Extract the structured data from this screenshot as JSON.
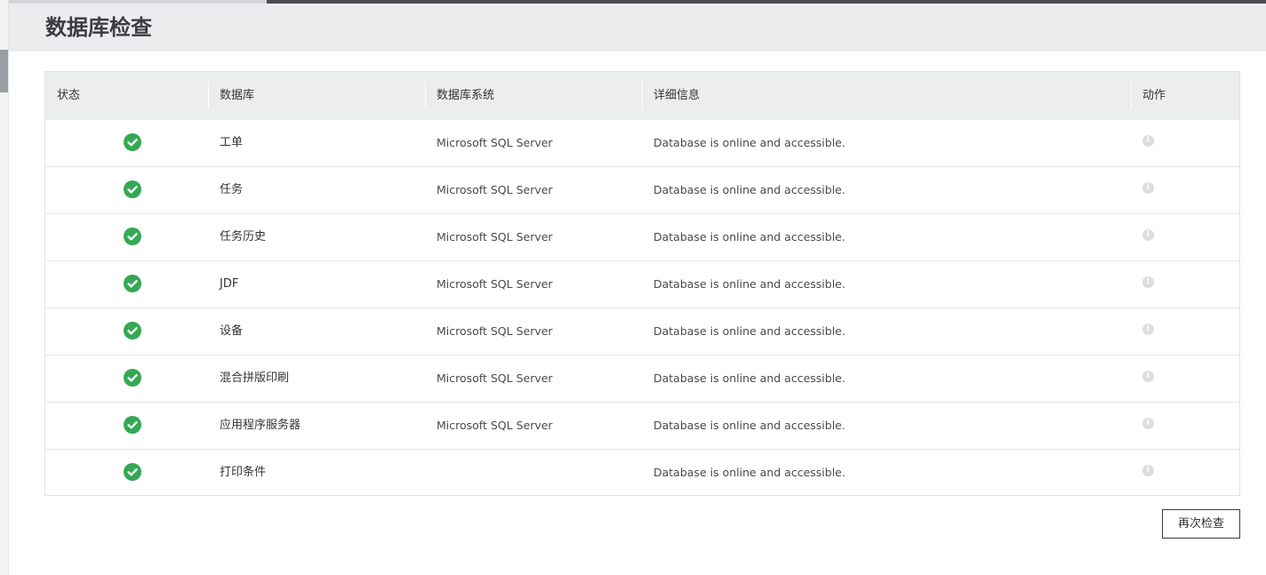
{
  "page": {
    "title": "数据库检查"
  },
  "table": {
    "headers": {
      "status": "状态",
      "database": "数据库",
      "system": "数据库系统",
      "details": "详细信息",
      "action": "动作"
    },
    "rows": [
      {
        "status": "ok",
        "database": "工单",
        "system": "Microsoft SQL Server",
        "details": "Database is online and accessible."
      },
      {
        "status": "ok",
        "database": "任务",
        "system": "Microsoft SQL Server",
        "details": "Database is online and accessible."
      },
      {
        "status": "ok",
        "database": "任务历史",
        "system": "Microsoft SQL Server",
        "details": "Database is online and accessible."
      },
      {
        "status": "ok",
        "database": "JDF",
        "system": "Microsoft SQL Server",
        "details": "Database is online and accessible."
      },
      {
        "status": "ok",
        "database": "设备",
        "system": "Microsoft SQL Server",
        "details": "Database is online and accessible."
      },
      {
        "status": "ok",
        "database": "混合拼版印刷",
        "system": "Microsoft SQL Server",
        "details": "Database is online and accessible."
      },
      {
        "status": "ok",
        "database": "应用程序服务器",
        "system": "Microsoft SQL Server",
        "details": "Database is online and accessible."
      },
      {
        "status": "ok",
        "database": "打印条件",
        "system": "",
        "details": "Database is online and accessible."
      }
    ]
  },
  "actions": {
    "recheck_label": "再次检查"
  },
  "icons": {
    "status_ok": "check-circle-icon",
    "row_action": "info-icon"
  },
  "colors": {
    "status_ok": "#34a853",
    "header_bg": "#ebeced",
    "action_icon": "#dcdddf"
  }
}
